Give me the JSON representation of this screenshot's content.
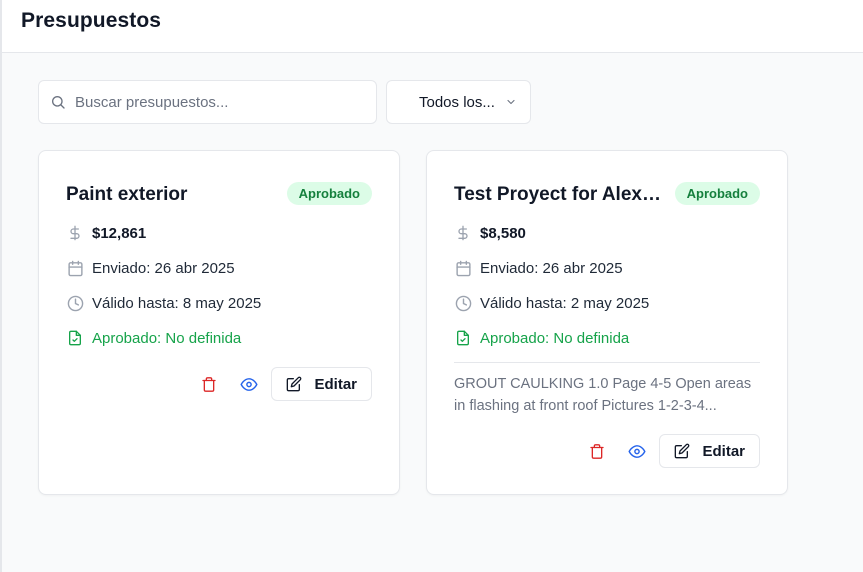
{
  "header": {
    "title": "Presupuestos"
  },
  "search": {
    "placeholder": "Buscar presupuestos..."
  },
  "filter": {
    "selected": "Todos los..."
  },
  "colors": {
    "approved_bg": "#dcfce7",
    "approved_text": "#15803d",
    "delete": "#dc2626",
    "view": "#2563eb"
  },
  "cards": [
    {
      "title": "Paint exterior",
      "status": "Aprobado",
      "amount": "$12,861",
      "sent": "Enviado: 26 abr 2025",
      "valid_until": "Válido hasta: 8 may 2025",
      "approved": "Aprobado: No definida",
      "notes": "",
      "edit_label": "Editar"
    },
    {
      "title": "Test Proyect for Alex Do...",
      "status": "Aprobado",
      "amount": "$8,580",
      "sent": "Enviado: 26 abr 2025",
      "valid_until": "Válido hasta: 2 may 2025",
      "approved": "Aprobado: No definida",
      "notes": "GROUT CAULKING 1.0 Page 4-5 Open areas in flashing at front roof Pictures 1-2-3-4...",
      "edit_label": "Editar"
    }
  ]
}
